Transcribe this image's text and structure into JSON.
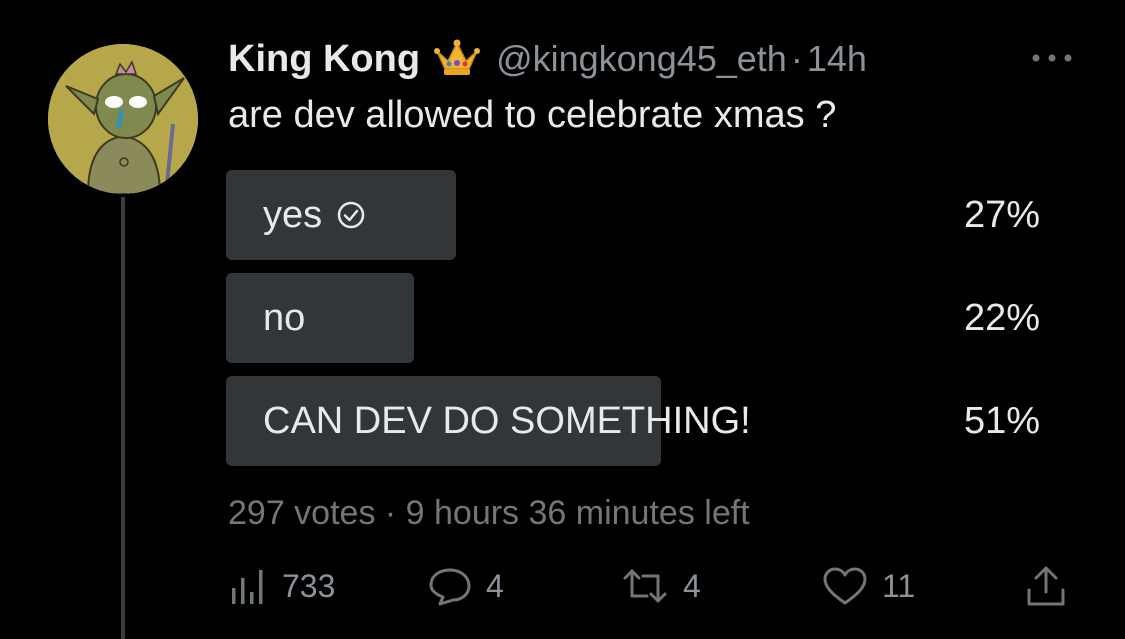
{
  "tweet": {
    "author_name": "King Kong",
    "handle": "@kingkong45_eth",
    "separator": "·",
    "time": "14h",
    "text": "are dev allowed to celebrate xmas ?"
  },
  "poll": {
    "options": [
      {
        "label": "yes",
        "percent": "27%",
        "share": 0.27,
        "selected": true
      },
      {
        "label": "no",
        "percent": "22%",
        "share": 0.22,
        "selected": false
      },
      {
        "label": "CAN DEV DO SOMETHING!",
        "percent": "51%",
        "share": 0.51,
        "selected": false
      }
    ],
    "meta": "297 votes · 9 hours 36 minutes left"
  },
  "actions": {
    "views": "733",
    "replies": "4",
    "retweets": "4",
    "likes": "11"
  },
  "colors": {
    "background": "#000000",
    "text": "#e7e9ea",
    "secondary": "#71767b",
    "poll_bar": "#333639"
  }
}
